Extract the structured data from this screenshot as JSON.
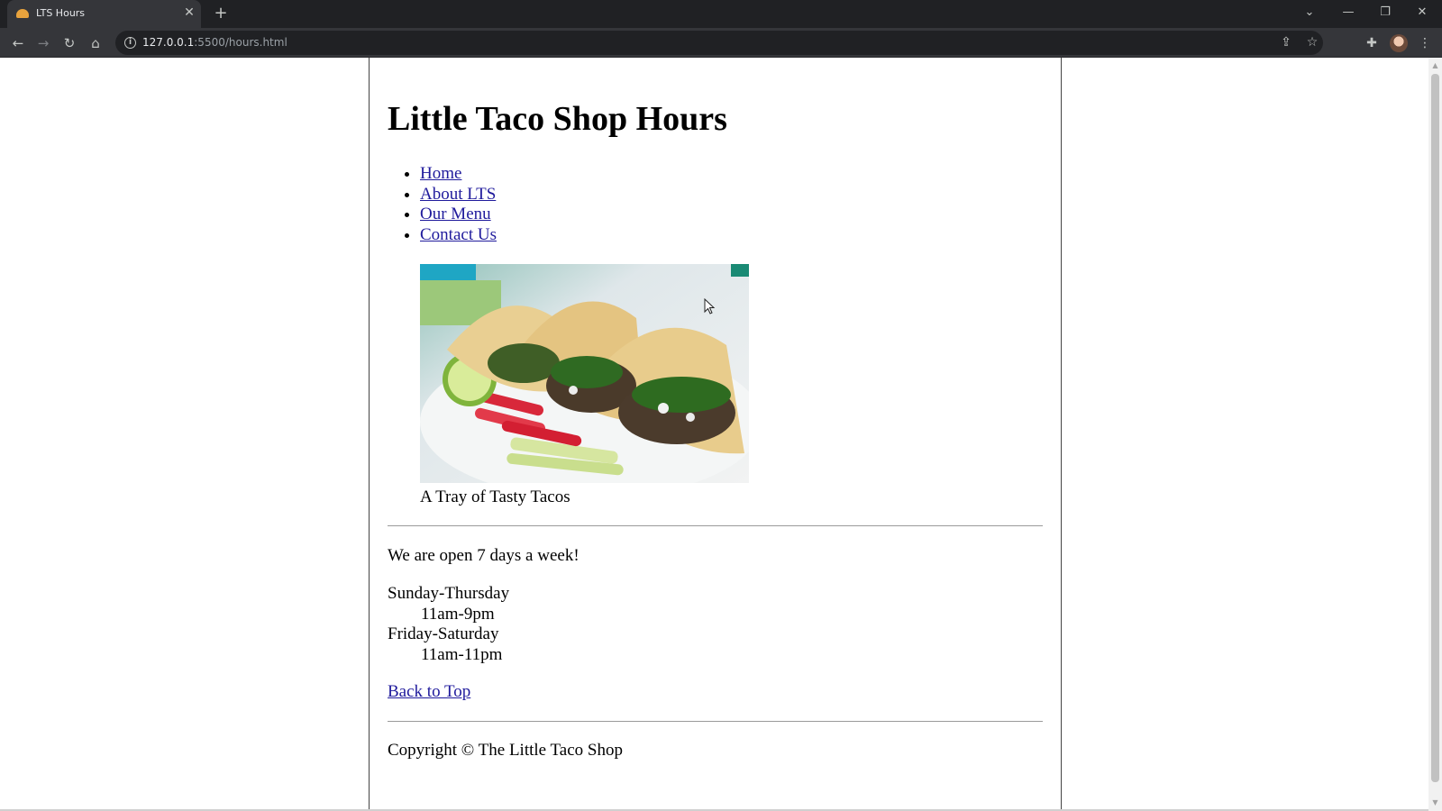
{
  "browser": {
    "tab_title": "LTS Hours",
    "tab_close": "✕",
    "new_tab": "+",
    "url_host": "127.0.0.1",
    "url_rest": ":5500/hours.html",
    "controls": {
      "tab_search": "⌄",
      "minimize": "—",
      "restore": "❐",
      "close": "✕"
    },
    "nav": {
      "back": "←",
      "forward": "→",
      "reload": "↻",
      "home": "⌂"
    },
    "icons": {
      "share": "⇪",
      "bookmark": "☆",
      "extensions": "✚",
      "menu": "⋮",
      "info": "i"
    },
    "favicon_color": "#e8a33d"
  },
  "page": {
    "title": "Little Taco Shop Hours",
    "nav": [
      {
        "label": "Home"
      },
      {
        "label": "About LTS"
      },
      {
        "label": "Our Menu"
      },
      {
        "label": "Contact Us"
      }
    ],
    "figure_caption": "A Tray of Tasty Tacos",
    "open_text": "We are open 7 days a week!",
    "hours": [
      {
        "days": "Sunday-Thursday",
        "time": "11am-9pm"
      },
      {
        "days": "Friday-Saturday",
        "time": "11am-11pm"
      }
    ],
    "back_to_top": "Back to Top",
    "copyright": "Copyright © The Little Taco Shop",
    "link_color": "#1f1a9c"
  },
  "scrollbar": {
    "up": "▲",
    "down": "▼"
  }
}
